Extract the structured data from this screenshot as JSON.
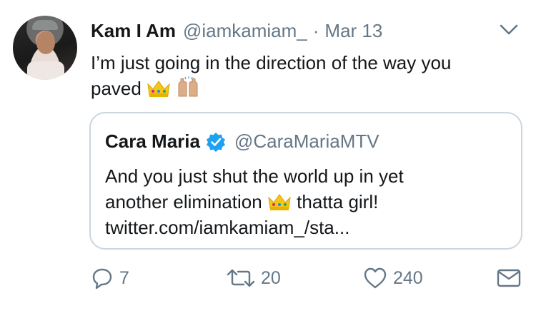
{
  "tweet": {
    "author_name": "Kam I Am",
    "author_handle": "@iamkamiam_",
    "separator": "·",
    "date": "Mar 13",
    "text_line1": "I’m just going in the direction of the way you",
    "text_line2_prefix": "paved"
  },
  "quoted": {
    "author_name": "Cara Maria",
    "author_handle": "@CaraMariaMTV",
    "line1": "And you just shut the world up in yet",
    "line2_prefix": "another elimination",
    "line2_suffix": "thatta girl!",
    "line3": "twitter.com/iamkamiam_/sta..."
  },
  "actions": {
    "reply_count": "7",
    "retweet_count": "20",
    "like_count": "240"
  },
  "colors": {
    "text": "#14171a",
    "secondary": "#657786",
    "border": "#ccd6dd",
    "verified": "#1da1f2",
    "crown": "#f5c518"
  },
  "icons": [
    "chevron-down-icon",
    "crown-emoji-icon",
    "raised-hands-emoji-icon",
    "verified-badge-icon",
    "reply-icon",
    "retweet-icon",
    "like-icon",
    "message-icon"
  ]
}
